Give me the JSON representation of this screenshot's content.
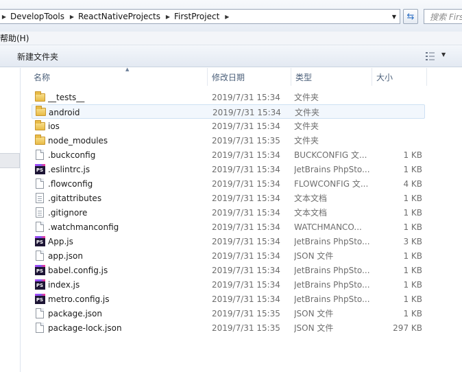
{
  "address_bar": {
    "breadcrumbs": [
      "DevelopTools",
      "ReactNativeProjects",
      "FirstProject"
    ],
    "search_placeholder": "搜索 First"
  },
  "menu": {
    "items": [
      "帮助(H)"
    ]
  },
  "toolbar": {
    "new_folder_label": "新建文件夹"
  },
  "columns": {
    "name": "名称",
    "date": "修改日期",
    "type": "类型",
    "size": "大小"
  },
  "files": [
    {
      "name": "__tests__",
      "date": "2019/7/31 15:34",
      "type": "文件夹",
      "size": "",
      "icon": "folder-icon"
    },
    {
      "name": "android",
      "date": "2019/7/31 15:34",
      "type": "文件夹",
      "size": "",
      "icon": "folder-icon",
      "selected": true
    },
    {
      "name": "ios",
      "date": "2019/7/31 15:34",
      "type": "文件夹",
      "size": "",
      "icon": "folder-icon"
    },
    {
      "name": "node_modules",
      "date": "2019/7/31 15:35",
      "type": "文件夹",
      "size": "",
      "icon": "folder-icon"
    },
    {
      "name": ".buckconfig",
      "date": "2019/7/31 15:34",
      "type": "BUCKCONFIG 文...",
      "size": "1 KB",
      "icon": "file-icon"
    },
    {
      "name": ".eslintrc.js",
      "date": "2019/7/31 15:34",
      "type": "JetBrains PhpSto...",
      "size": "1 KB",
      "icon": "phpstorm-icon"
    },
    {
      "name": ".flowconfig",
      "date": "2019/7/31 15:34",
      "type": "FLOWCONFIG 文...",
      "size": "4 KB",
      "icon": "file-icon"
    },
    {
      "name": ".gitattributes",
      "date": "2019/7/31 15:34",
      "type": "文本文档",
      "size": "1 KB",
      "icon": "text-file-icon"
    },
    {
      "name": ".gitignore",
      "date": "2019/7/31 15:34",
      "type": "文本文档",
      "size": "1 KB",
      "icon": "text-file-icon"
    },
    {
      "name": ".watchmanconfig",
      "date": "2019/7/31 15:34",
      "type": "WATCHMANCO...",
      "size": "1 KB",
      "icon": "file-icon"
    },
    {
      "name": "App.js",
      "date": "2019/7/31 15:34",
      "type": "JetBrains PhpSto...",
      "size": "3 KB",
      "icon": "phpstorm-icon"
    },
    {
      "name": "app.json",
      "date": "2019/7/31 15:34",
      "type": "JSON 文件",
      "size": "1 KB",
      "icon": "file-icon"
    },
    {
      "name": "babel.config.js",
      "date": "2019/7/31 15:34",
      "type": "JetBrains PhpSto...",
      "size": "1 KB",
      "icon": "phpstorm-icon"
    },
    {
      "name": "index.js",
      "date": "2019/7/31 15:34",
      "type": "JetBrains PhpSto...",
      "size": "1 KB",
      "icon": "phpstorm-icon"
    },
    {
      "name": "metro.config.js",
      "date": "2019/7/31 15:34",
      "type": "JetBrains PhpSto...",
      "size": "1 KB",
      "icon": "phpstorm-icon"
    },
    {
      "name": "package.json",
      "date": "2019/7/31 15:35",
      "type": "JSON 文件",
      "size": "1 KB",
      "icon": "file-icon"
    },
    {
      "name": "package-lock.json",
      "date": "2019/7/31 15:35",
      "type": "JSON 文件",
      "size": "297 KB",
      "icon": "file-icon"
    }
  ]
}
